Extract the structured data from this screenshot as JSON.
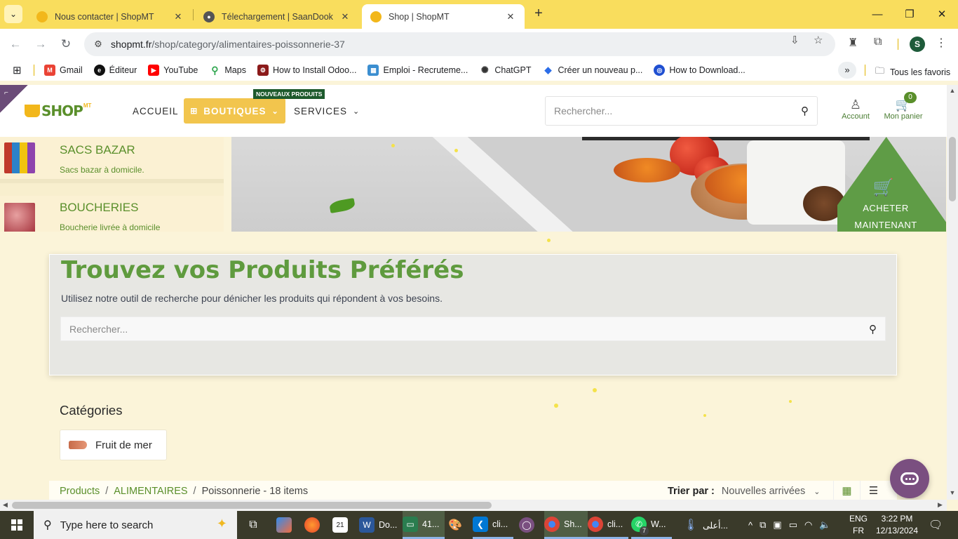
{
  "browser": {
    "tabs": [
      {
        "title": "Nous contacter | ShopMT",
        "active": false
      },
      {
        "title": "Télechargement | SaanDook",
        "active": false
      },
      {
        "title": "Shop | ShopMT",
        "active": true
      }
    ],
    "url_host": "shopmt.fr",
    "url_path": "/shop/category/alimentaires-poissonnerie-37",
    "profile_initial": "S",
    "bookmarks": [
      {
        "label": "Gmail",
        "color": "#ea4335",
        "glyph": "M"
      },
      {
        "label": "Éditeur",
        "color": "#111111",
        "glyph": "e"
      },
      {
        "label": "YouTube",
        "color": "#ff0000",
        "glyph": "▶"
      },
      {
        "label": "Maps",
        "color": "#34a853",
        "glyph": "●"
      },
      {
        "label": "How to Install Odoo...",
        "color": "#8b1a1a",
        "glyph": "⚙"
      },
      {
        "label": "Emploi - Recruteme...",
        "color": "#3b8ed0",
        "glyph": "▦"
      },
      {
        "label": "ChatGPT",
        "color": "#555555",
        "glyph": "✺"
      },
      {
        "label": "Créer un nouveau p...",
        "color": "#2b6de8",
        "glyph": "◆"
      },
      {
        "label": "How to Download...",
        "color": "#1f4fd1",
        "glyph": "◎"
      }
    ],
    "all_bookmarks_label": "Tous les favoris"
  },
  "header": {
    "nav": {
      "home": "ACCUEIL",
      "shops": "BOUTIQUES",
      "services": "SERVICES",
      "new_badge": "NOUVEAUX PRODUITS"
    },
    "search_placeholder": "Rechercher...",
    "account_label": "Account",
    "cart_label": "Mon panier",
    "cart_count": "0"
  },
  "hero": {
    "categories": [
      {
        "name": "SACS BAZAR",
        "desc": "Sacs bazar à domicile."
      },
      {
        "name": "BOUCHERIES",
        "desc": "Boucherie livrée à domicile"
      }
    ],
    "cta_line1": "ACHETER",
    "cta_line2": "MAINTENANT"
  },
  "finder": {
    "title": "Trouvez vos Produits Préférés",
    "subtitle": "Utilisez notre outil de recherche pour dénicher les produits qui répondent à vos besoins.",
    "search_placeholder": "Rechercher..."
  },
  "categories_section": {
    "title": "Catégories",
    "chips": [
      {
        "label": "Fruit de mer"
      }
    ]
  },
  "breadcrumb": {
    "items": [
      "Products",
      "ALIMENTAIRES"
    ],
    "current": "Poissonnerie - 18 items"
  },
  "sort": {
    "label": "Trier par :",
    "value": "Nouvelles arrivées"
  },
  "taskbar": {
    "search_placeholder": "Type here to search",
    "apps": [
      {
        "label": "Do...",
        "icon": "word-icon",
        "color": "#2b579a"
      },
      {
        "label": "41...",
        "icon": "video-icon",
        "color": "#2a7d4f"
      },
      {
        "label": "cli...",
        "icon": "vscode-icon",
        "color": "#0078d4"
      },
      {
        "label": "Sh...",
        "icon": "chrome-icon",
        "color": "#db4437"
      },
      {
        "label": "cli...",
        "icon": "chrome-icon",
        "color": "#db4437"
      },
      {
        "label": "W...",
        "icon": "whatsapp-icon",
        "color": "#25d366"
      },
      {
        "label": "أعلى...",
        "icon": "weather-icon",
        "color": "#3a7bd5"
      }
    ],
    "whatsapp_badge": "7",
    "lang_line1": "ENG",
    "lang_line2": "FR",
    "time": "3:22 PM",
    "date": "12/13/2024"
  }
}
